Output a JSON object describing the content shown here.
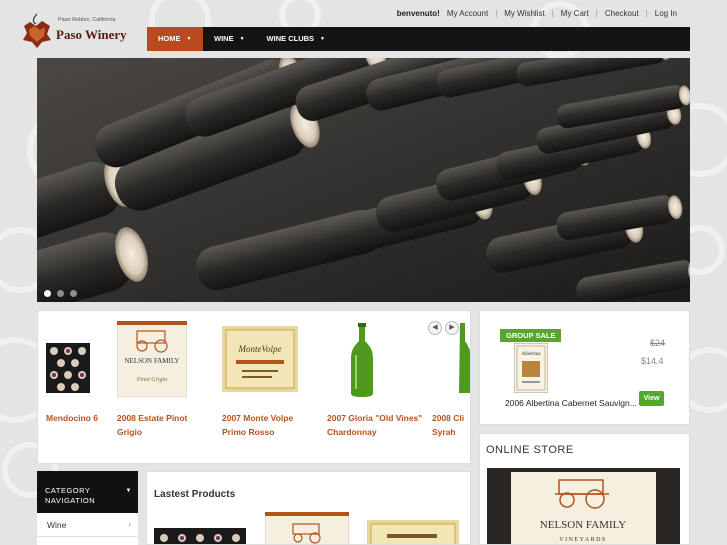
{
  "brand": {
    "tagline": "Paso Robles, California",
    "name": "Paso Winery"
  },
  "toplinks": {
    "greeting": "benvenuto!",
    "my_account": "My Account",
    "my_wishlist": "My Wishlist",
    "my_cart": "My Cart",
    "checkout": "Checkout",
    "login": "Log In"
  },
  "nav": {
    "items": [
      {
        "label": "HOME"
      },
      {
        "label": "WINE"
      },
      {
        "label": "WINE CLUBS"
      }
    ]
  },
  "slider": {
    "slide_count": 3,
    "active_slide": 1
  },
  "carousel": {
    "products": [
      {
        "title_line1": "Mendocino 6",
        "title_line2": ""
      },
      {
        "title_line1": "2008 Estate Pinot",
        "title_line2": "Grigio"
      },
      {
        "title_line1": "2007 Monte Volpe",
        "title_line2": "Primo Rosso"
      },
      {
        "title_line1": "2007 Gloria \"Old Vines\"",
        "title_line2": "Chardonnay"
      },
      {
        "title_line1": "2008 Cli",
        "title_line2": "Syrah"
      }
    ],
    "label_nelson": "NELSON FAMILY",
    "label_montevolpe": "MonteVolpe"
  },
  "group_sale": {
    "badge": "GROUP SALE",
    "old_price": "$24",
    "new_price": "$14.4",
    "product_name": "2006 Albertina Cabernet Sauvign...",
    "view_label": "View",
    "label_albertina": "Albertina"
  },
  "online_store": {
    "heading": "ONLINE STORE",
    "image_label": "NELSON FAMILY",
    "image_sub": "VINEYARDS"
  },
  "category_nav": {
    "heading_line1": "CATEGORY",
    "heading_line2": "NAVIGATION",
    "items": [
      {
        "label": "Wine"
      }
    ]
  },
  "latest": {
    "heading": "Lastest Products"
  },
  "colors": {
    "nav_active": "#b94a1e",
    "product_title": "#b5531d",
    "green": "#5aa531"
  }
}
